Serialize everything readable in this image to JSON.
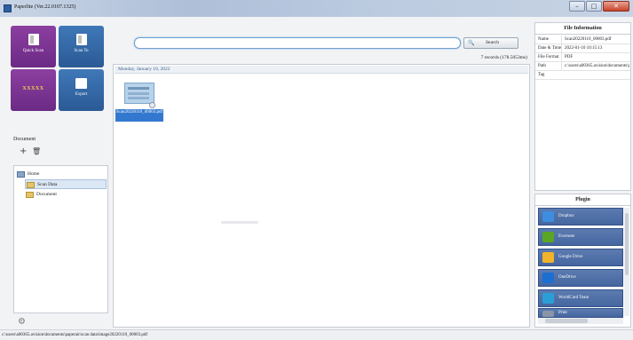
{
  "window": {
    "title": "Paperlite  (Ver.22.0107.1325)",
    "buttons": {
      "minimize": "–",
      "maximize": "□",
      "close": "✕"
    }
  },
  "sidebar": {
    "tiles": {
      "quick_scan": "Quick Scan",
      "scan_to": "Scan To",
      "custom_profile": "XXXXX",
      "export": "Export"
    },
    "section_label": "Document",
    "add_icon": "+",
    "delete_icon": "🗑",
    "tree": [
      {
        "label": "Home",
        "kind": "home",
        "level": 0,
        "selected": false
      },
      {
        "label": "Scan Data",
        "kind": "folder",
        "level": 1,
        "selected": true
      },
      {
        "label": "Document",
        "kind": "folder",
        "level": 1,
        "selected": false
      }
    ],
    "settings_icon": "⚙"
  },
  "main": {
    "search": {
      "value": "",
      "placeholder": ""
    },
    "search_button_icon": "🔍",
    "search_button": "Search",
    "result_summary": "7 records  (178.5053ms)",
    "date_group": "Monday, January 10, 2022",
    "files": [
      {
        "name": "Scan20220110_00003.pdf"
      }
    ]
  },
  "file_info": {
    "header": "File Information",
    "rows": [
      {
        "key": "Name",
        "value": "Scan20220110_00003.pdf"
      },
      {
        "key": "Date & Time",
        "value": "2022-01-10 10:15:13"
      },
      {
        "key": "File Format",
        "value": "PDF"
      },
      {
        "key": "Path",
        "value": "c:\\users\\a00365.avision\\documents\\paperair\\scan data\\"
      },
      {
        "key": "Tag",
        "value": ""
      }
    ]
  },
  "plugins": {
    "header": "Plugin",
    "items": [
      {
        "label": "Dropbox",
        "icon": "dropbox-icon",
        "color": "#3d8de0"
      },
      {
        "label": "Evernote",
        "icon": "evernote-icon",
        "color": "#5ba525"
      },
      {
        "label": "Google Drive",
        "icon": "google-drive-icon",
        "color": "#f1b32a"
      },
      {
        "label": "OneDrive",
        "icon": "onedrive-icon",
        "color": "#1c6fd1"
      },
      {
        "label": "WorldCard Team",
        "icon": "worldcard-icon",
        "color": "#2a9fd6"
      },
      {
        "label": "Print",
        "icon": "print-icon",
        "color": "#8a95a5"
      }
    ]
  },
  "status_bar": {
    "path": "c:\\users\\a00365.avision\\documents\\paperair\\scan data\\image20220110_00003.pdf"
  }
}
